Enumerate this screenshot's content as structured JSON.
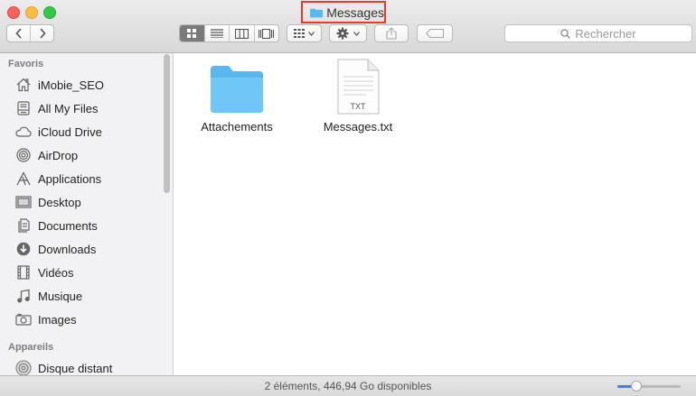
{
  "window": {
    "title": "Messages"
  },
  "toolbar": {
    "search_placeholder": "Rechercher",
    "active_view": "icon-view"
  },
  "sidebar": {
    "favorites_header": "Favoris",
    "favorites": [
      {
        "label": "iMobie_SEO",
        "icon": "home-icon"
      },
      {
        "label": "All My Files",
        "icon": "all-files-icon"
      },
      {
        "label": "iCloud Drive",
        "icon": "cloud-icon"
      },
      {
        "label": "AirDrop",
        "icon": "airdrop-icon"
      },
      {
        "label": "Applications",
        "icon": "applications-icon"
      },
      {
        "label": "Desktop",
        "icon": "desktop-icon"
      },
      {
        "label": "Documents",
        "icon": "documents-icon"
      },
      {
        "label": "Downloads",
        "icon": "downloads-icon"
      },
      {
        "label": "Vidéos",
        "icon": "video-icon"
      },
      {
        "label": "Musique",
        "icon": "music-icon"
      },
      {
        "label": "Images",
        "icon": "camera-icon"
      }
    ],
    "devices_header": "Appareils",
    "devices": [
      {
        "label": "Disque distant",
        "icon": "disc-icon"
      }
    ]
  },
  "content": {
    "files": [
      {
        "name": "Attachements",
        "type": "folder"
      },
      {
        "name": "Messages.txt",
        "type": "txt",
        "badge": "TXT"
      }
    ]
  },
  "statusbar": {
    "text": "2 éléments, 446,94 Go disponibles",
    "zoom_level": 0.25
  },
  "colors": {
    "folder": "#5ab8f0",
    "highlight_box": "#e8392b",
    "slider_fill": "#3b82e8"
  }
}
